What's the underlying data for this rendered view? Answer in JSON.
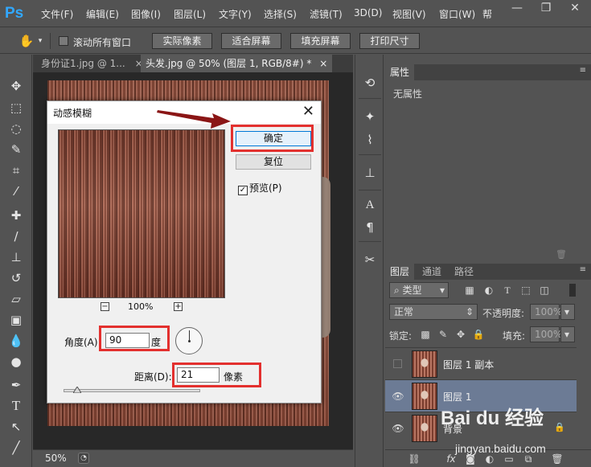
{
  "app": {
    "logo": "Ps",
    "menus": [
      "文件(F)",
      "编辑(E)",
      "图像(I)",
      "图层(L)",
      "文字(Y)",
      "选择(S)",
      "滤镜(T)",
      "3D(D)",
      "视图(V)",
      "窗口(W)",
      "帮"
    ],
    "window_controls": [
      "minimize-icon",
      "restore-icon",
      "close-icon"
    ]
  },
  "options": {
    "tool_icon": "hand-icon",
    "scroll_all_label": "滚动所有窗口",
    "scroll_all_checked": false,
    "actual_pixels": "实际像素",
    "fit_screen": "适合屏幕",
    "fill_screen": "填充屏幕",
    "print_size": "打印尺寸"
  },
  "tabs": [
    {
      "label": "身份证1.jpg @ 1...",
      "close": "×",
      "active": false
    },
    {
      "label": "头发.jpg @ 50% (图层 1, RGB/8#) *",
      "close": "×",
      "active": true
    }
  ],
  "status": {
    "zoom": "50%"
  },
  "dialog": {
    "title": "动感模糊",
    "close": "✕",
    "ok": "确定",
    "reset": "复位",
    "preview_label": "预览(P)",
    "preview_checked": true,
    "zoom_minus": "−",
    "zoom_plus": "+",
    "zoom_level": "100%",
    "angle_label": "角度(A):",
    "angle_value": "90",
    "angle_unit": "度",
    "distance_label": "距离(D):",
    "distance_value": "21",
    "distance_unit": "像素",
    "distance_slider": 0.1
  },
  "properties": {
    "tab": "属性",
    "empty": "无属性"
  },
  "layers": {
    "tabs": [
      "图层",
      "通道",
      "路径"
    ],
    "filter_kind": "类型",
    "blend_mode": "正常",
    "opacity_label": "不透明度:",
    "opacity_value": "100%",
    "lock_label": "锁定:",
    "fill_label": "填充:",
    "fill_value": "100%",
    "items": [
      {
        "name": "图层 1 副本",
        "visible": false,
        "selected": false
      },
      {
        "name": "图层 1",
        "visible": true,
        "selected": true
      },
      {
        "name": "背景",
        "visible": true,
        "selected": false
      }
    ],
    "footer_icons": [
      "link-icon",
      "fx-icon",
      "mask-icon",
      "adjustment-icon",
      "folder-icon",
      "new-layer-icon",
      "trash-icon"
    ]
  },
  "watermark": {
    "brand": "Bai du 经验",
    "url": "jingyan.baidu.com"
  }
}
